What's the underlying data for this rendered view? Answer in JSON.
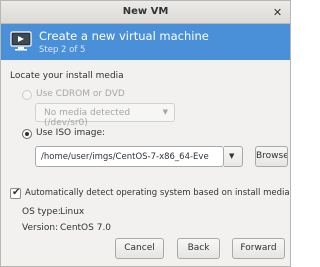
{
  "window": {
    "title": "New VM",
    "close_glyph": "✕"
  },
  "header": {
    "title": "Create a new virtual machine",
    "step": "Step 2 of 5",
    "icon": "vm-monitor-icon",
    "accent": "#4a90d9"
  },
  "install_media": {
    "section_label": "Locate your install media",
    "cdrom": {
      "label": "Use CDROM or DVD",
      "selected": false,
      "enabled": false
    },
    "cdrom_combo": {
      "value": "No media detected (/dev/sr0)",
      "enabled": false
    },
    "iso": {
      "label": "Use ISO image:",
      "selected": true
    },
    "iso_path": {
      "value": "/home/user/imgs/CentOS-7-x86_64-Eve"
    },
    "browse_label": "Browse..."
  },
  "os_detect": {
    "checkbox_label": "Automatically detect operating system based on install media",
    "checked": true,
    "os_type_label": "OS type:",
    "os_type_value": "Linux",
    "version_label": "Version:",
    "version_value": "CentOS 7.0"
  },
  "footer": {
    "cancel_label": "Cancel",
    "back_label": "Back",
    "forward_label": "Forward"
  }
}
